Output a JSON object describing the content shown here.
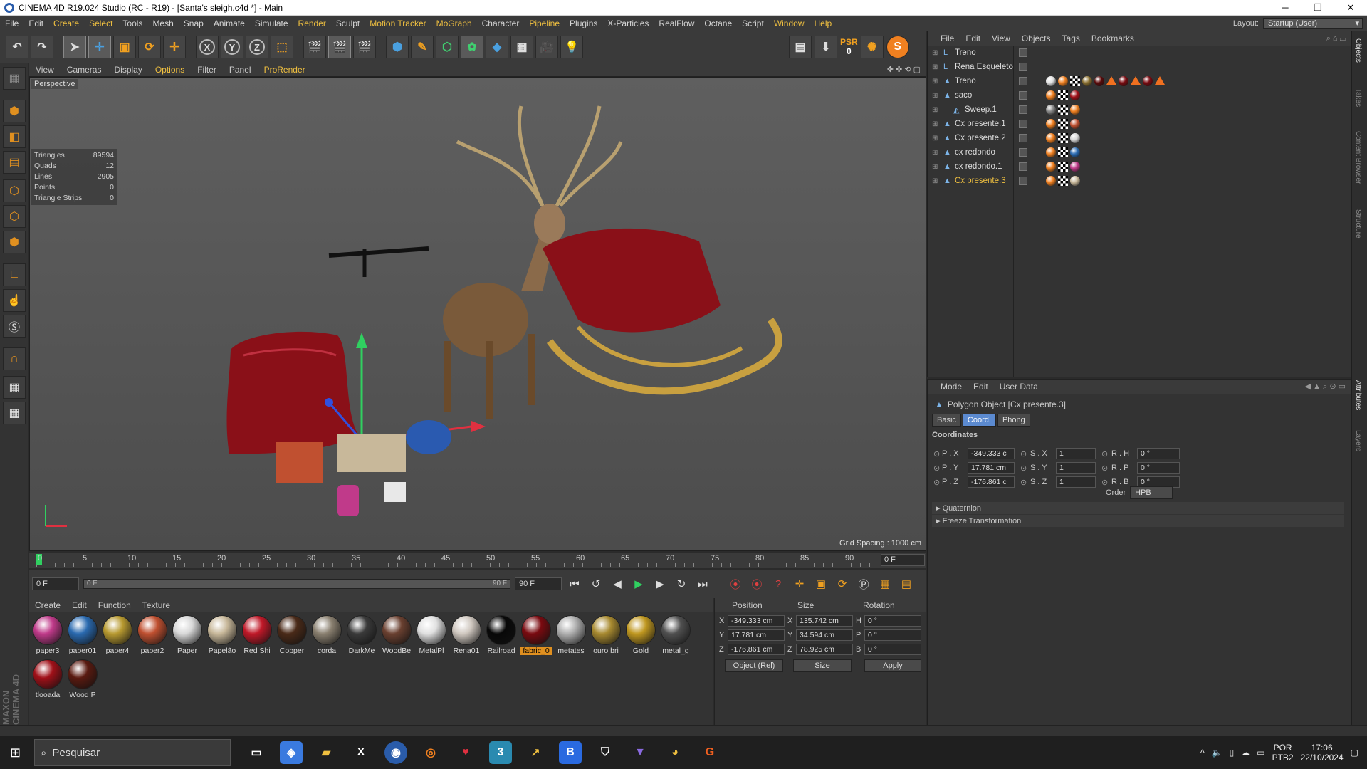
{
  "window": {
    "title": "CINEMA 4D R19.024 Studio (RC - R19) - [Santa's sleigh.c4d *] - Main"
  },
  "menu": {
    "items": [
      "File",
      "Edit",
      "Create",
      "Select",
      "Tools",
      "Mesh",
      "Snap",
      "Animate",
      "Simulate",
      "Render",
      "Sculpt",
      "Motion Tracker",
      "MoGraph",
      "Character",
      "Pipeline",
      "Plugins",
      "X-Particles",
      "RealFlow",
      "Octane",
      "Script",
      "Window",
      "Help"
    ],
    "layout_label": "Layout:",
    "layout_value": "Startup (User)"
  },
  "toolbar": {
    "psr_label": "PSR",
    "psr_value": "0"
  },
  "viewport": {
    "menu": [
      "View",
      "Cameras",
      "Display",
      "Options",
      "Filter",
      "Panel",
      "ProRender"
    ],
    "label": "Perspective",
    "stats": [
      {
        "k": "Triangles",
        "v": "89594"
      },
      {
        "k": "Quads",
        "v": "12"
      },
      {
        "k": "Lines",
        "v": "2905"
      },
      {
        "k": "Points",
        "v": "0"
      },
      {
        "k": "Triangle Strips",
        "v": "0"
      }
    ],
    "grid_spacing": "Grid Spacing : 1000 cm"
  },
  "timeline": {
    "ticks": [
      "0",
      "5",
      "10",
      "15",
      "20",
      "25",
      "30",
      "35",
      "40",
      "45",
      "50",
      "55",
      "60",
      "65",
      "70",
      "75",
      "80",
      "85",
      "90"
    ],
    "current_frame": "0 F"
  },
  "playbar": {
    "start": "0 F",
    "range_start": "0 F",
    "range_end": "90 F",
    "end": "90 F"
  },
  "materials": {
    "menu": [
      "Create",
      "Edit",
      "Function",
      "Texture"
    ],
    "items": [
      {
        "name": "paper3",
        "color": "#c03a8a"
      },
      {
        "name": "paper01",
        "color": "#2a6ab0"
      },
      {
        "name": "paper4",
        "color": "#b89a30"
      },
      {
        "name": "paper2",
        "color": "#c05030"
      },
      {
        "name": "Paper",
        "color": "#d8d8d8"
      },
      {
        "name": "Papelão",
        "color": "#c8b89a"
      },
      {
        "name": "Red Shi",
        "color": "#c01828"
      },
      {
        "name": "Copper",
        "color": "#4a2a18"
      },
      {
        "name": "corda",
        "color": "#8a8070"
      },
      {
        "name": "DarkMe",
        "color": "#3a3a3a"
      },
      {
        "name": "WoodBe",
        "color": "#6a4030"
      },
      {
        "name": "MetalPl",
        "color": "#e0e0e0"
      },
      {
        "name": "Rena01",
        "color": "#d0c8c0"
      },
      {
        "name": "Railroad",
        "color": "#080808"
      },
      {
        "name": "fabric_0",
        "color": "#7a0a10"
      },
      {
        "name": "metates",
        "color": "#b0b0b0"
      },
      {
        "name": "ouro bri",
        "color": "#a88a30"
      },
      {
        "name": "Gold",
        "color": "#c09820"
      },
      {
        "name": "metal_g",
        "color": "#505050"
      },
      {
        "name": "tlooada",
        "color": "#a01018"
      },
      {
        "name": "Wood P",
        "color": "#5a1a10"
      }
    ],
    "selected": "fabric_0"
  },
  "coords": {
    "headers": [
      "Position",
      "Size",
      "Rotation"
    ],
    "rows": [
      {
        "axis": "X",
        "pos": "-349.333 cm",
        "size_axis": "X",
        "size": "135.742 cm",
        "rot_axis": "H",
        "rot": "0 °"
      },
      {
        "axis": "Y",
        "pos": "17.781 cm",
        "size_axis": "Y",
        "size": "34.594 cm",
        "rot_axis": "P",
        "rot": "0 °"
      },
      {
        "axis": "Z",
        "pos": "-176.861 cm",
        "size_axis": "Z",
        "size": "78.925 cm",
        "rot_axis": "B",
        "rot": "0 °"
      }
    ],
    "mode": "Object (Rel)",
    "size_mode": "Size",
    "apply": "Apply"
  },
  "objects": {
    "menu": [
      "File",
      "Edit",
      "View",
      "Objects",
      "Tags",
      "Bookmarks"
    ],
    "items": [
      {
        "name": "Treno",
        "icon": "null-icon",
        "indent": 0,
        "tags": []
      },
      {
        "name": "Rena Esqueleto",
        "icon": "null-icon",
        "indent": 0,
        "tags": []
      },
      {
        "name": "Treno",
        "icon": "polygon-icon",
        "indent": 0,
        "tags": [
          "#e0e0e0",
          "#f08020",
          "#000",
          "#8a7030",
          "#5a0a0a",
          "tri",
          "#7a0a10",
          "tri",
          "#7a0a10",
          "tri"
        ]
      },
      {
        "name": "saco",
        "icon": "polygon-icon",
        "indent": 0,
        "tags": [
          "#f08020",
          "#000",
          "#a01018"
        ]
      },
      {
        "name": "Sweep.1",
        "icon": "sweep-icon",
        "indent": 1,
        "tags": [
          "#888",
          "#000",
          "#f08020"
        ]
      },
      {
        "name": "Cx presente.1",
        "icon": "polygon-icon",
        "indent": 0,
        "tags": [
          "#f08020",
          "#000",
          "#c05030"
        ]
      },
      {
        "name": "Cx presente.2",
        "icon": "polygon-icon",
        "indent": 0,
        "tags": [
          "#f08020",
          "#000",
          "#d8d8d8"
        ]
      },
      {
        "name": "cx redondo",
        "icon": "polygon-icon",
        "indent": 0,
        "tags": [
          "#f08020",
          "#000",
          "#2a6ab0"
        ]
      },
      {
        "name": "cx redondo.1",
        "icon": "polygon-icon",
        "indent": 0,
        "tags": [
          "#f08020",
          "#000",
          "#c03a8a"
        ]
      },
      {
        "name": "Cx presente.3",
        "icon": "polygon-icon",
        "indent": 0,
        "tags": [
          "#f08020",
          "#000",
          "#c8b89a"
        ],
        "selected": true
      }
    ]
  },
  "attributes": {
    "menu": [
      "Mode",
      "Edit",
      "User Data"
    ],
    "object_title": "Polygon Object [Cx presente.3]",
    "tabs": [
      "Basic",
      "Coord.",
      "Phong"
    ],
    "active_tab": "Coord.",
    "section": "Coordinates",
    "fields": [
      {
        "label": "P . X",
        "value": "-349.333 c",
        "slabel": "S . X",
        "svalue": "1",
        "rlabel": "R . H",
        "rvalue": "0 °"
      },
      {
        "label": "P . Y",
        "value": "17.781 cm",
        "slabel": "S . Y",
        "svalue": "1",
        "rlabel": "R . P",
        "rvalue": "0 °"
      },
      {
        "label": "P . Z",
        "value": "-176.861 c",
        "slabel": "S . Z",
        "svalue": "1",
        "rlabel": "R . B",
        "rvalue": "0 °"
      }
    ],
    "order_label": "Order",
    "order_value": "HPB",
    "collapsed": [
      "Quaternion",
      "Freeze Transformation"
    ]
  },
  "right_strip": [
    "Objects",
    "Takes",
    "Content Browser",
    "Structure",
    "Attributes",
    "Layers"
  ],
  "taskbar": {
    "search_placeholder": "Pesquisar",
    "lang": "POR",
    "lang2": "PTB2",
    "time": "17:06",
    "date": "22/10/2024"
  },
  "brand": "MAXON CINEMA 4D"
}
